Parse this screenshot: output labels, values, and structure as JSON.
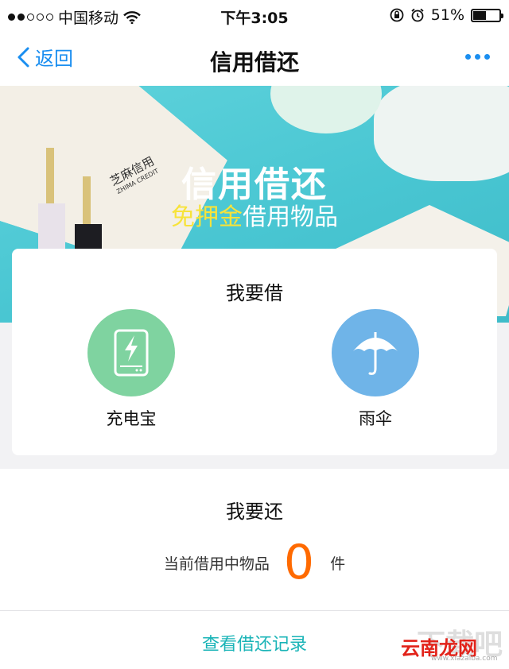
{
  "status_bar": {
    "carrier": "中国移动",
    "time": "下午3:05",
    "battery_text": "51%",
    "battery_level": 0.51
  },
  "nav": {
    "back_label": "返回",
    "title": "信用借还"
  },
  "banner": {
    "title": "信用借还",
    "subtitle_highlight": "免押金",
    "subtitle_rest": "借用物品",
    "umbrella_text": "芝麻信用",
    "umbrella_text_en": "ZHIMA CREDIT"
  },
  "borrow": {
    "title": "我要借",
    "items": [
      {
        "label": "充电宝",
        "icon": "power-bank-icon",
        "color": "#7fd3a0"
      },
      {
        "label": "雨伞",
        "icon": "umbrella-icon",
        "color": "#6fb4e8"
      }
    ]
  },
  "return": {
    "title": "我要还",
    "count_label": "当前借用中物品",
    "count": "0",
    "count_unit": "件",
    "history_link": "查看借还记录"
  },
  "watermark": {
    "text": "云南龙网",
    "url": "www.xiazaiba.com",
    "bg_text": "下载吧"
  },
  "colors": {
    "accent": "#1a8ef0",
    "count": "#ff6a00",
    "link": "#1ab4b7",
    "banner": "#49c6d2"
  }
}
